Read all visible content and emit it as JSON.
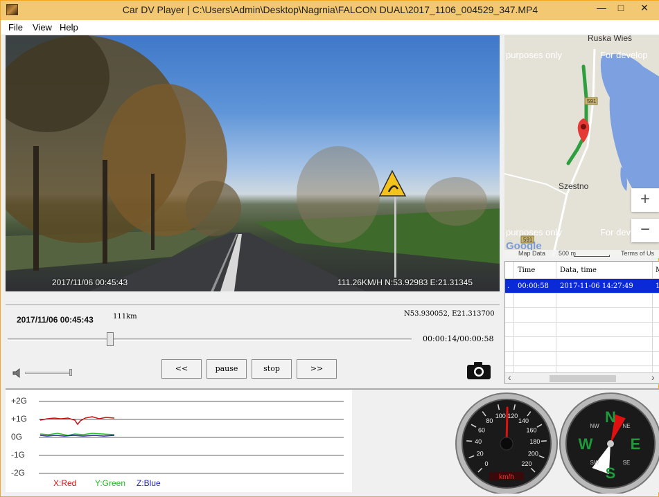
{
  "window": {
    "title": "Car DV Player | C:\\Users\\Admin\\Desktop\\Nagrnia\\FALCON DUAL\\2017_1106_004529_347.MP4",
    "minimize": "—",
    "maximize": "□",
    "close": "✕"
  },
  "menu": {
    "file": "File",
    "view": "View",
    "help": "Help"
  },
  "video": {
    "osd_date": "2017/11/06 00:45:43",
    "osd_gps": "111.26KM/H N:53.92983 E:21.31345"
  },
  "map": {
    "place_top": "Ruska Wieś",
    "watermark_1": "purposes only",
    "watermark_2": "For develop",
    "watermark_3": "purposes only",
    "watermark_4": "For dev",
    "town": "Szestno",
    "road_1": "591",
    "road_2": "591",
    "zoom_in": "+",
    "zoom_out": "−",
    "logo": "Google",
    "footer_data": "Map Data",
    "footer_scale": "500 m",
    "footer_terms": "Terms of Us",
    "route_color": "#2e9e3e",
    "marker_color": "#e53935"
  },
  "table": {
    "headers": [
      "Time",
      "Data, time",
      "M"
    ],
    "rows": [
      {
        "index": ".",
        "time": "00:00:58",
        "datetime": "2017-11-06 14:27:49",
        "m": "1",
        "selected": true
      }
    ],
    "scroll_left": "‹",
    "scroll_right": "›"
  },
  "controls": {
    "date": "2017/11/06 00:45:43",
    "distance": "111km",
    "coords": "N53.930052, E21.313700",
    "time_display": "00:00:14/00:00:58",
    "progress": 0.25,
    "buttons": {
      "prev": "<<",
      "pause": "pause",
      "stop": "stop",
      "next": ">>"
    }
  },
  "gsensor": {
    "axis_labels": [
      "+2G",
      "+1G",
      "0G",
      "-1G",
      "-2G"
    ],
    "legend": {
      "x": "X:Red",
      "y": "Y:Green",
      "z": "Z:Blue"
    },
    "colors": {
      "x": "#cc1111",
      "y": "#22bb22",
      "z": "#2222bb"
    }
  },
  "speedometer": {
    "ticks": [
      "0",
      "20",
      "40",
      "60",
      "80",
      "100",
      "120",
      "140",
      "160",
      "180",
      "200",
      "220"
    ],
    "unit": "km/h",
    "value_kmh": 111
  },
  "compass": {
    "n": "N",
    "e": "E",
    "s": "S",
    "w": "W",
    "ne": "NE",
    "nw": "NW",
    "se": "SE",
    "sw": "SW"
  }
}
